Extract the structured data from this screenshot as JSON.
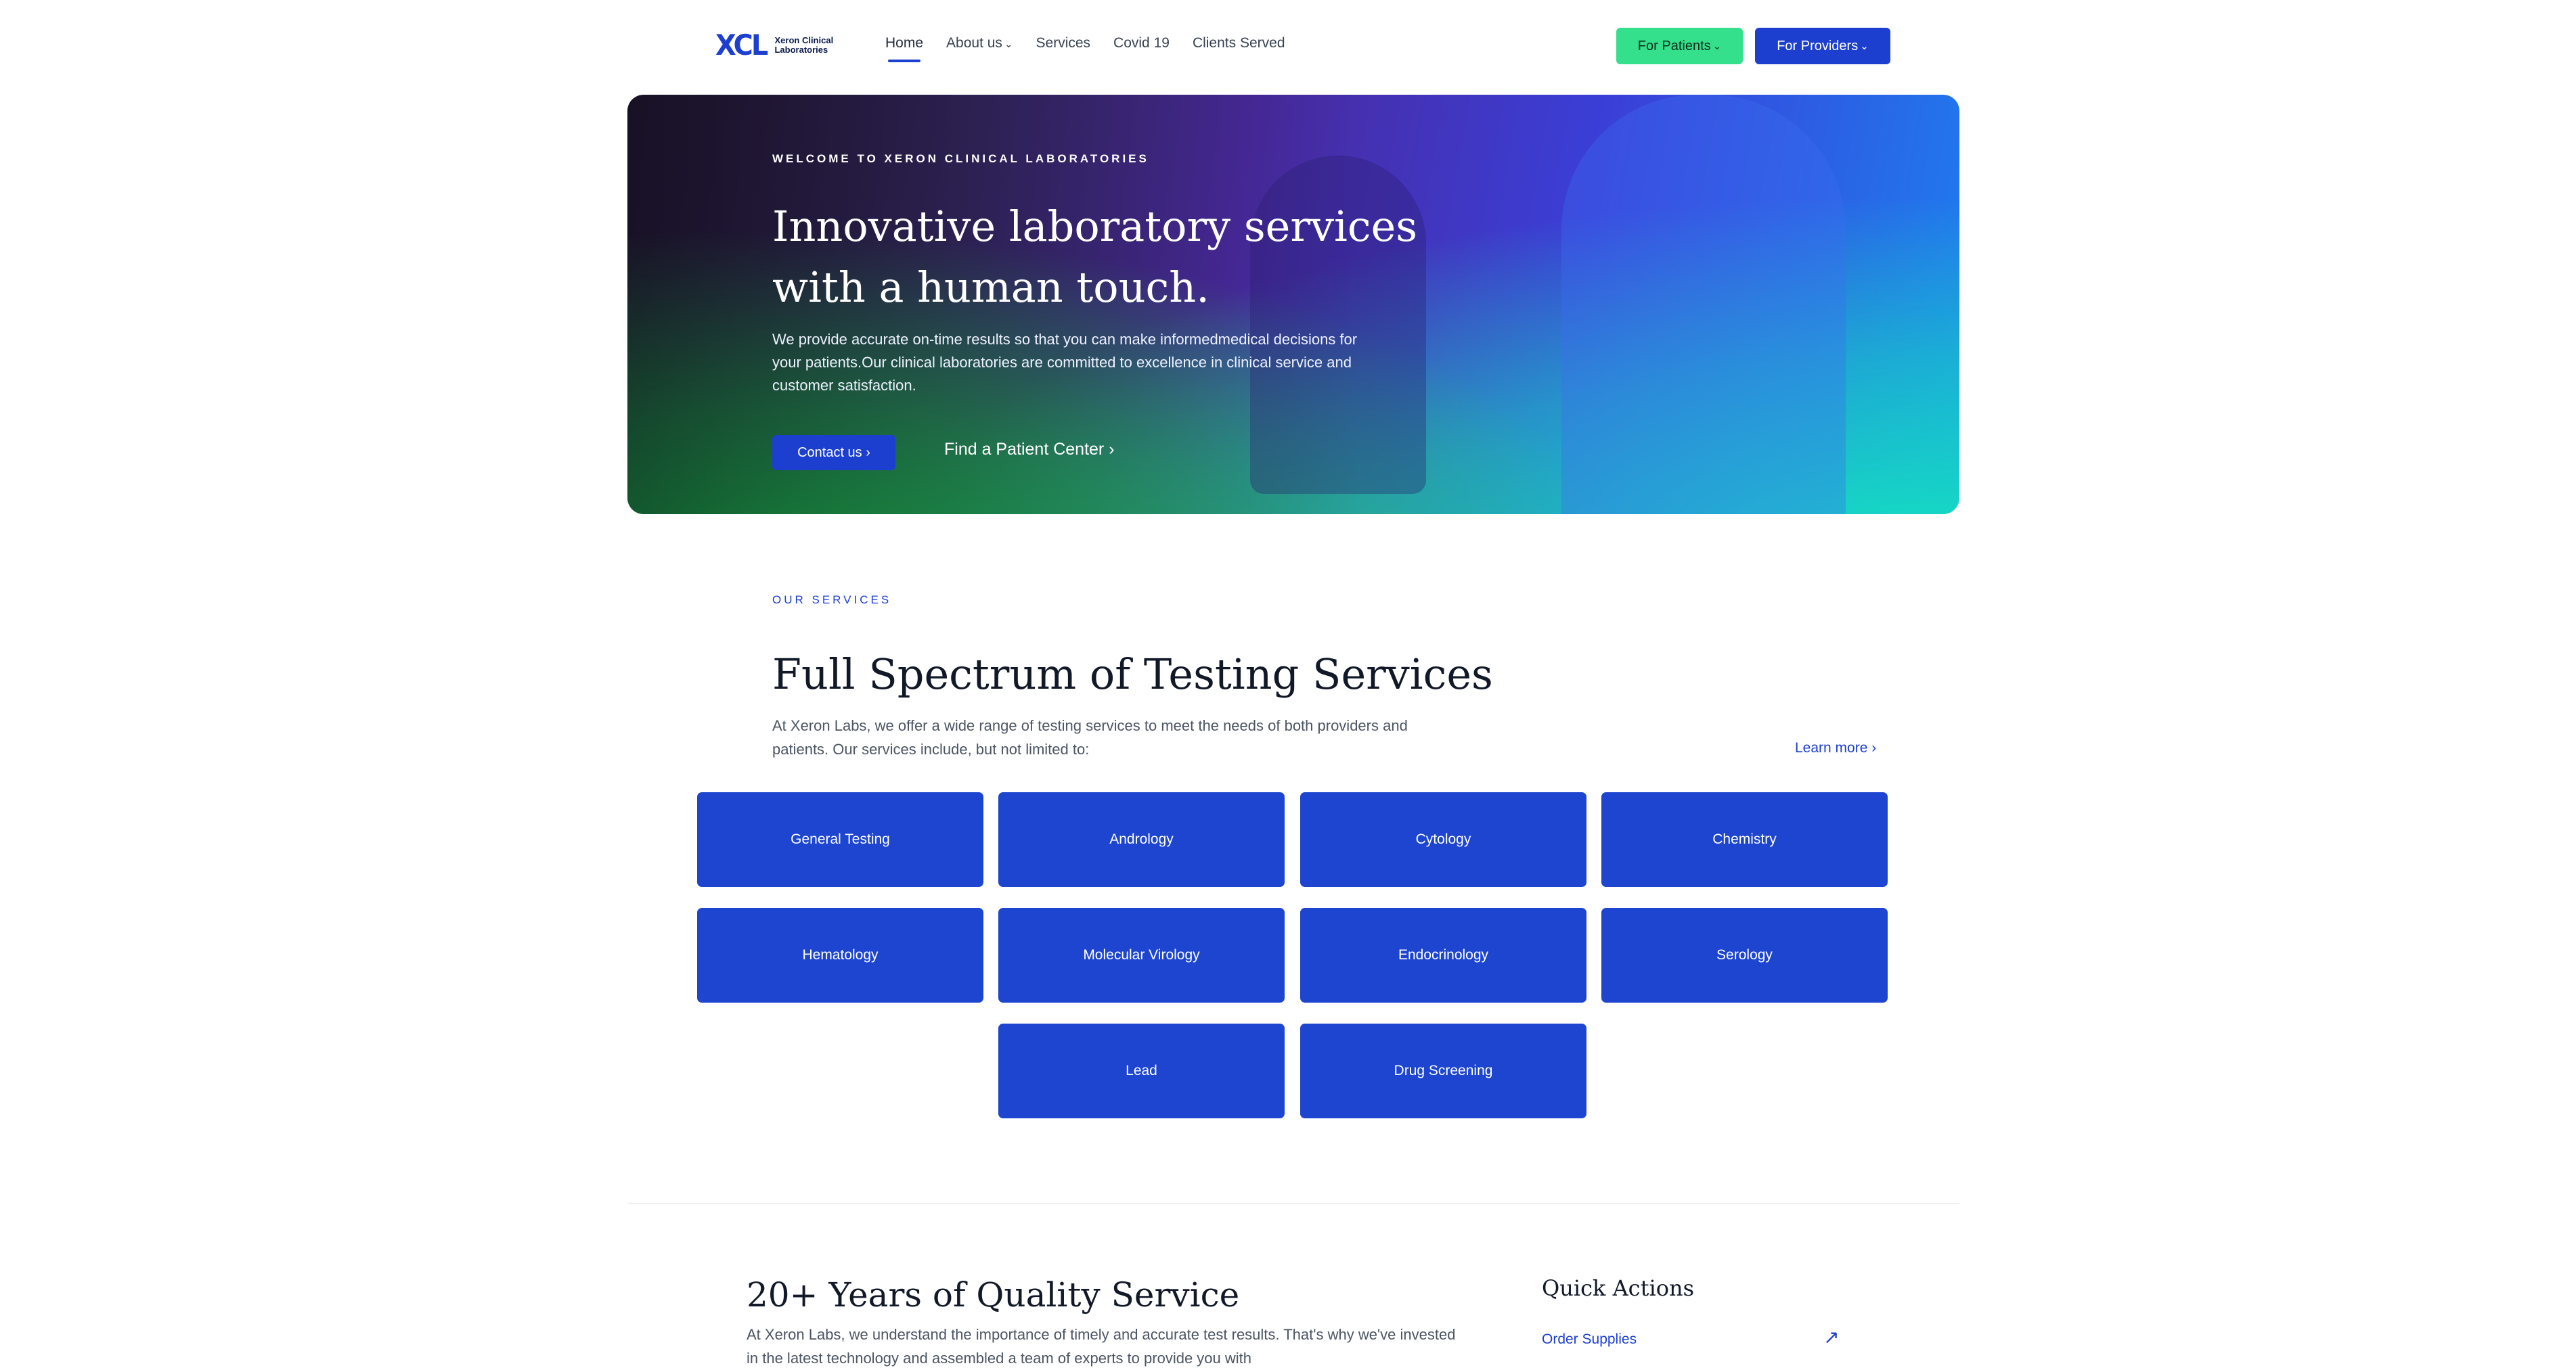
{
  "nav": {
    "logo_mark": "XCL",
    "logo_text": "Xeron Clinical Laboratories",
    "links": [
      "Home",
      "About us",
      "Services",
      "Covid 19",
      "Clients Served"
    ],
    "patients_btn": "For Patients",
    "providers_btn": "For Providers"
  },
  "hero": {
    "eyebrow": "WELCOME TO XERON CLINICAL LABORATORIES",
    "title": "Innovative laboratory services with a human touch.",
    "description": "We provide accurate on-time results so that you can make informedmedical decisions for your patients.Our clinical laboratories are committed to excellence in clinical service and customer satisfaction.",
    "contact_btn": "Contact us ›",
    "find_link": "Find a Patient Center ›"
  },
  "services": {
    "eyebrow": "OUR SERVICES",
    "title": "Full Spectrum of Testing Services",
    "description": "At Xeron Labs, we offer a wide range of testing services to meet the needs of both providers and patients. Our services include, but not limited to:",
    "learn_more": "Learn more ›",
    "tiles": [
      "General Testing",
      "Andrology",
      "Cytology",
      "Chemistry",
      "Hematology",
      "Molecular Virology",
      "Endocrinology",
      "Serology",
      "Lead",
      "Drug Screening"
    ]
  },
  "about": {
    "title": "20+ Years of Quality Service",
    "description": "At Xeron Labs, we understand the importance of timely and accurate test results. That's why we've invested in the latest technology and assembled a team of experts to provide you with"
  },
  "quick_actions": {
    "title": "Quick Actions",
    "items": [
      "Order Supplies"
    ]
  },
  "colors": {
    "brand_blue": "#1d3fd0",
    "patients_green": "#34e08b"
  }
}
